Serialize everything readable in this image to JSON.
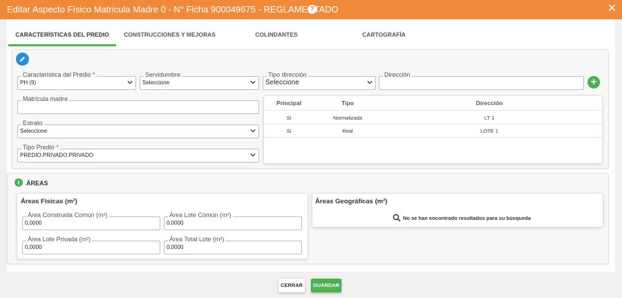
{
  "window": {
    "title": "Editar Aspecto Físico Matricula Madre 0 - N° Ficha 900049675 - REGLAMENTADO",
    "help_symbol": "?",
    "close_symbol": "✕"
  },
  "tabs": [
    {
      "label": "CARACTERÍSTICAS DEL PREDIO",
      "active": true
    },
    {
      "label": "CONSTRUCCIONES Y MEJORAS"
    },
    {
      "label": "COLINDANTES"
    },
    {
      "label": "CARTOGRAFÍA"
    }
  ],
  "form": {
    "caracteristica": {
      "label": "Característica del Predio",
      "required": "*",
      "value": "PH (9)"
    },
    "servidumbre": {
      "label": "Servidumbre",
      "value": "Seleccione"
    },
    "tipo_direccion": {
      "label": "Tipo dirección",
      "value": "Seleccione"
    },
    "direccion": {
      "label": "Dirección",
      "value": ""
    },
    "matricula_madre": {
      "label": "Matrícula madre",
      "value": ""
    },
    "estrato": {
      "label": "Estrato",
      "value": "Seleccione"
    },
    "tipo_predio": {
      "label": "Tipo Predio",
      "required": "*",
      "value": "PREDIO.PRIVADO.PRIVADO"
    }
  },
  "address_table": {
    "headers": [
      "Principal",
      "Tipo",
      "Dirección"
    ],
    "rows": [
      [
        "Si",
        "Normalizada",
        "LT 1"
      ],
      [
        "Si",
        "Real",
        "LOTE 1"
      ]
    ]
  },
  "areas": {
    "section_title": "ÁREAS",
    "fisicas": {
      "title": "Áreas Físicas (m²)",
      "area_construida_comun": {
        "label": "Área Construida Común (m²)",
        "value": "0,0000"
      },
      "area_lote_comun": {
        "label": "Área Lote Común (m²)",
        "value": "0,0000"
      },
      "area_lote_privada": {
        "label": "Área Lote Privada (m²)",
        "value": "0,0000"
      },
      "area_total_lote": {
        "label": "Área Total Lote (m²)",
        "value": "0,0000"
      }
    },
    "geograficas": {
      "title": "Áreas Geográficas (m²)",
      "empty_message": "No se han encontrado resultados para su búsqueda"
    }
  },
  "footer": {
    "close_label": "CERRAR",
    "save_label": "GUARDAR"
  },
  "colors": {
    "header": "#f08a3a",
    "accent_green": "#4caf50",
    "edit_blue": "#2e8bd8"
  }
}
